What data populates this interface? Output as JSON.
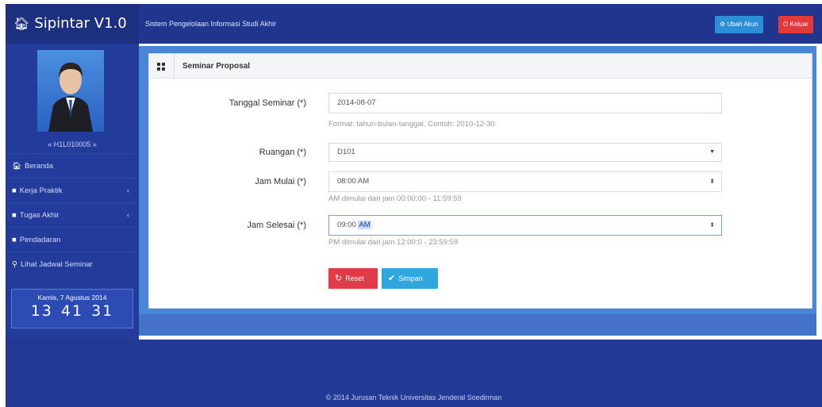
{
  "header": {
    "brand": "Sipintar V1.0",
    "subtitle": "Sistem Pengelolaan Informasi Studi Akhir",
    "account_button": "Ubah Akun",
    "logout_button": "Keluar"
  },
  "sidebar": {
    "user_id": "« H1L010005 »",
    "items": [
      {
        "label": "Beranda",
        "icon": "home-icon"
      },
      {
        "label": "Kerja Praktik",
        "icon": "book-icon",
        "chevron": "‹"
      },
      {
        "label": "Tugas Akhir",
        "icon": "book-icon",
        "chevron": "‹"
      },
      {
        "label": "Pendadaran",
        "icon": "book-icon"
      },
      {
        "label": "Lihat Jadwal Seminar",
        "icon": "search-icon"
      }
    ],
    "clock": {
      "date": "Kamis, 7 Agustus 2014",
      "hour": "13",
      "minute": "41",
      "second": "31"
    }
  },
  "panel": {
    "title": "Seminar Proposal",
    "fields": {
      "tanggal": {
        "label": "Tanggal Seminar (*)",
        "value": "2014-08-07",
        "hint": "Format: tahun-bulan-tanggal. Contoh: 2010-12-30."
      },
      "ruangan": {
        "label": "Ruangan (*)",
        "value": "D101"
      },
      "jam_mulai": {
        "label": "Jam Mulai (*)",
        "value": "08:00 AM",
        "hint": "AM dimulai dari jam 00:00:00 - 11:59:59"
      },
      "jam_selesai": {
        "label": "Jam Selesai (*)",
        "value_prefix": "09:00 ",
        "value_selected": "AM",
        "hint": "PM dimulai dari jam 12:00:0 - 23:59:59"
      }
    },
    "reset_button": "Reset",
    "save_button": "Simpan"
  },
  "footer": {
    "text": "© 2014 Jurusan Teknik Universitas Jenderal Soedirman"
  },
  "colors": {
    "navbar": "#21358f",
    "sidebar": "#233b9b",
    "reset": "#e13b48",
    "save": "#2ea6e0",
    "logout": "#e23a3a",
    "account": "#2d8ed8"
  }
}
